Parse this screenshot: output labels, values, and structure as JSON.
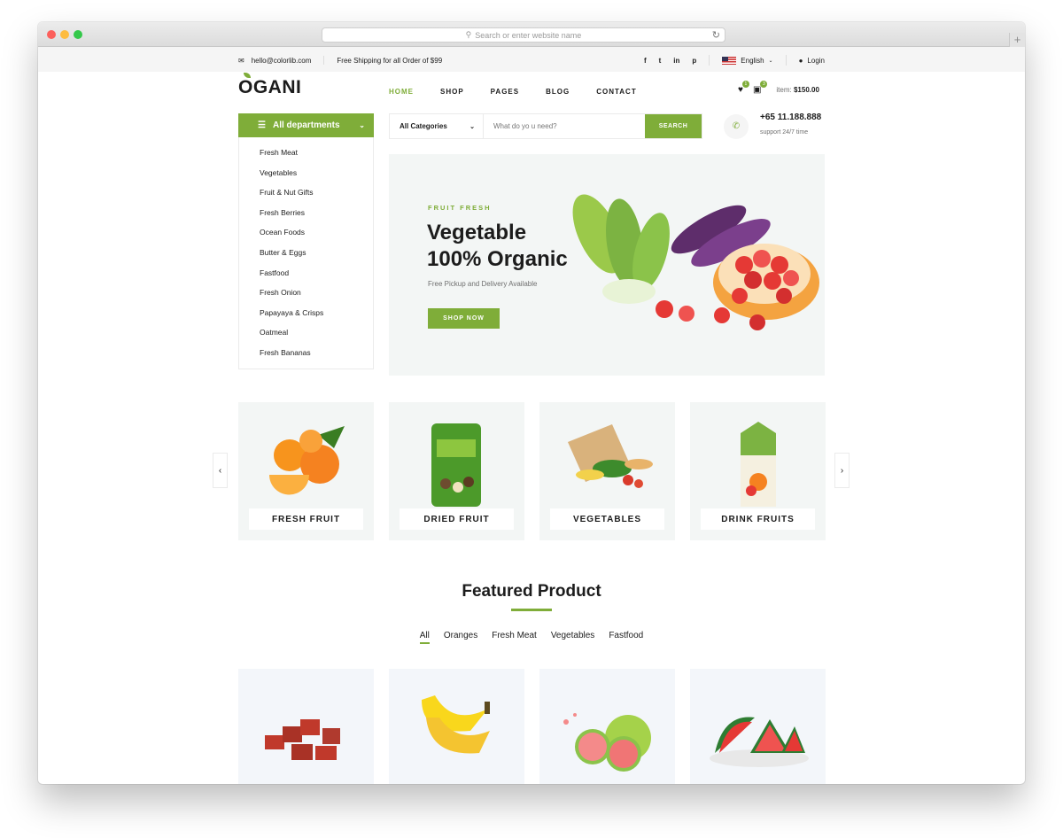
{
  "browser": {
    "url_placeholder": "Search or enter website name"
  },
  "topbar": {
    "email": "hello@colorlib.com",
    "shipping": "Free Shipping for all Order of $99",
    "social": [
      "f",
      "t",
      "in",
      "p"
    ],
    "language": "English",
    "login": "Login"
  },
  "header": {
    "logo": "OGANI",
    "nav": [
      "HOME",
      "SHOP",
      "PAGES",
      "BLOG",
      "CONTACT"
    ],
    "wishlist_count": "1",
    "cart_count": "3",
    "item_label": "item:",
    "item_total": "$150.00"
  },
  "departments": {
    "title": "All departments",
    "items": [
      "Fresh Meat",
      "Vegetables",
      "Fruit & Nut Gifts",
      "Fresh Berries",
      "Ocean Foods",
      "Butter & Eggs",
      "Fastfood",
      "Fresh Onion",
      "Papayaya & Crisps",
      "Oatmeal",
      "Fresh Bananas"
    ]
  },
  "search": {
    "category": "All Categories",
    "placeholder": "What do yo u need?",
    "button": "SEARCH"
  },
  "contact": {
    "phone": "+65 11.188.888",
    "support": "support 24/7 time"
  },
  "hero": {
    "kicker": "FRUIT FRESH",
    "title_line1": "Vegetable",
    "title_line2": "100% Organic",
    "subtitle": "Free Pickup and Delivery Available",
    "cta": "SHOP NOW"
  },
  "categories": [
    "FRESH FRUIT",
    "DRIED FRUIT",
    "VEGETABLES",
    "DRINK FRUITS"
  ],
  "featured": {
    "title": "Featured Product",
    "filters": [
      "All",
      "Oranges",
      "Fresh Meat",
      "Vegetables",
      "Fastfood"
    ]
  },
  "colors": {
    "accent": "#7fad39",
    "card_bg": "#f3f6fa"
  }
}
